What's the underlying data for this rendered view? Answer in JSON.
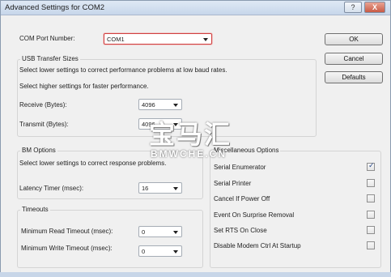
{
  "window": {
    "title": "Advanced Settings for COM2",
    "help_glyph": "?",
    "close_glyph": "X"
  },
  "port": {
    "label": "COM Port Number:",
    "value": "COM1"
  },
  "buttons": {
    "ok": "OK",
    "cancel": "Cancel",
    "defaults": "Defaults"
  },
  "usb": {
    "title": "USB Transfer Sizes",
    "desc1": "Select lower settings to correct performance problems at low baud rates.",
    "desc2": "Select higher settings for faster performance.",
    "receive_label": "Receive (Bytes):",
    "receive_value": "4096",
    "transmit_label": "Transmit (Bytes):",
    "transmit_value": "4096"
  },
  "bm": {
    "title": "BM Options",
    "desc": "Select lower settings to correct response problems.",
    "latency_label": "Latency Timer (msec):",
    "latency_value": "16"
  },
  "timeouts": {
    "title": "Timeouts",
    "read_label": "Minimum Read Timeout (msec):",
    "read_value": "0",
    "write_label": "Minimum Write Timeout (msec):",
    "write_value": "0"
  },
  "misc": {
    "title": "Miscellaneous Options",
    "items": [
      {
        "label": "Serial Enumerator",
        "checked": true
      },
      {
        "label": "Serial Printer",
        "checked": false
      },
      {
        "label": "Cancel If Power Off",
        "checked": false
      },
      {
        "label": "Event On Surprise Removal",
        "checked": false
      },
      {
        "label": "Set RTS On Close",
        "checked": false
      },
      {
        "label": "Disable Modem Ctrl At Startup",
        "checked": false
      }
    ]
  },
  "watermark": {
    "cn": "宝马汇",
    "en": "BMWCHE.CN"
  },
  "colors": {
    "focus_border": "#d04040",
    "checkmark": "#2a4b8a",
    "title_gradient_top": "#dfe9f5"
  }
}
